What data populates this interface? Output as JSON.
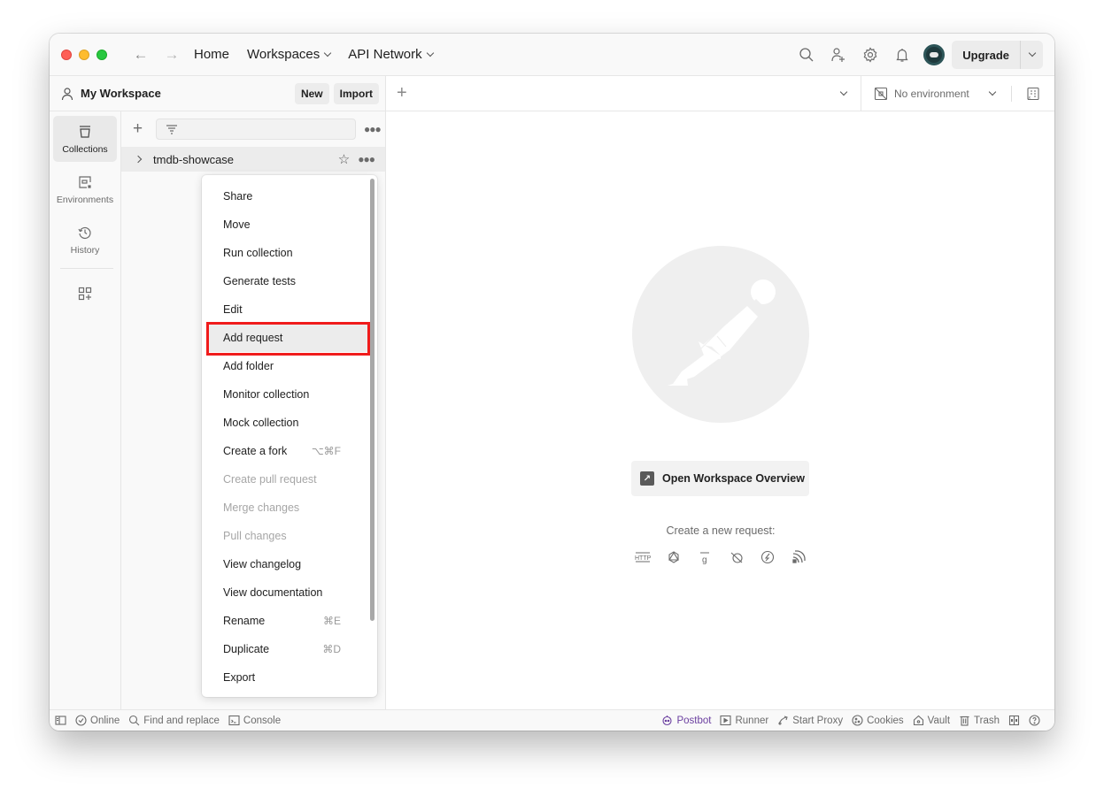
{
  "titlebar": {
    "nav": [
      {
        "label": "Home",
        "dropdown": false
      },
      {
        "label": "Workspaces",
        "dropdown": true
      },
      {
        "label": "API Network",
        "dropdown": true
      }
    ],
    "icons": [
      "search-icon",
      "invite-user-icon",
      "settings-icon",
      "notifications-icon"
    ],
    "upgrade_label": "Upgrade"
  },
  "workspace": {
    "title": "My Workspace",
    "new_label": "New",
    "import_label": "Import"
  },
  "environment": {
    "selected": "No environment"
  },
  "sidebar": {
    "items": [
      {
        "label": "Collections",
        "icon": "collections-icon",
        "active": true
      },
      {
        "label": "Environments",
        "icon": "environments-icon",
        "active": false
      },
      {
        "label": "History",
        "icon": "history-icon",
        "active": false
      }
    ]
  },
  "collections": {
    "search_placeholder": "",
    "items": [
      {
        "name": "tmdb-showcase",
        "expanded": false
      }
    ]
  },
  "context_menu": {
    "items": [
      {
        "label": "Share",
        "shortcut": "",
        "disabled": false
      },
      {
        "label": "Move",
        "shortcut": "",
        "disabled": false
      },
      {
        "label": "Run collection",
        "shortcut": "",
        "disabled": false
      },
      {
        "label": "Generate tests",
        "shortcut": "",
        "disabled": false
      },
      {
        "label": "Edit",
        "shortcut": "",
        "disabled": false
      },
      {
        "label": "Add request",
        "shortcut": "",
        "disabled": false,
        "highlighted": true
      },
      {
        "label": "Add folder",
        "shortcut": "",
        "disabled": false
      },
      {
        "label": "Monitor collection",
        "shortcut": "",
        "disabled": false
      },
      {
        "label": "Mock collection",
        "shortcut": "",
        "disabled": false
      },
      {
        "label": "Create a fork",
        "shortcut": "⌥⌘F",
        "disabled": false
      },
      {
        "label": "Create pull request",
        "shortcut": "",
        "disabled": true
      },
      {
        "label": "Merge changes",
        "shortcut": "",
        "disabled": true
      },
      {
        "label": "Pull changes",
        "shortcut": "",
        "disabled": true
      },
      {
        "label": "View changelog",
        "shortcut": "",
        "disabled": false
      },
      {
        "label": "View documentation",
        "shortcut": "",
        "disabled": false
      },
      {
        "label": "Rename",
        "shortcut": "⌘E",
        "disabled": false
      },
      {
        "label": "Duplicate",
        "shortcut": "⌘D",
        "disabled": false
      },
      {
        "label": "Export",
        "shortcut": "",
        "disabled": false
      }
    ]
  },
  "main": {
    "overview_button": "Open Workspace Overview",
    "new_request_label": "Create a new request:",
    "request_types": [
      "http-icon",
      "graphql-icon",
      "grpc-icon",
      "websocket-icon",
      "socketio-icon",
      "mqtt-icon"
    ]
  },
  "statusbar": {
    "left": [
      {
        "label": "",
        "icon": "toggle-sidebar-icon"
      },
      {
        "label": "Online",
        "icon": "online-check-icon"
      },
      {
        "label": "Find and replace",
        "icon": "search-icon"
      },
      {
        "label": "Console",
        "icon": "console-icon"
      }
    ],
    "right": [
      {
        "label": "Postbot",
        "icon": "postbot-icon"
      },
      {
        "label": "Runner",
        "icon": "runner-icon"
      },
      {
        "label": "Start Proxy",
        "icon": "proxy-icon"
      },
      {
        "label": "Cookies",
        "icon": "cookies-icon"
      },
      {
        "label": "Vault",
        "icon": "vault-icon"
      },
      {
        "label": "Trash",
        "icon": "trash-icon"
      }
    ]
  },
  "colors": {
    "highlight_box": "#f01c1c",
    "postbot": "#6b3fa0"
  }
}
